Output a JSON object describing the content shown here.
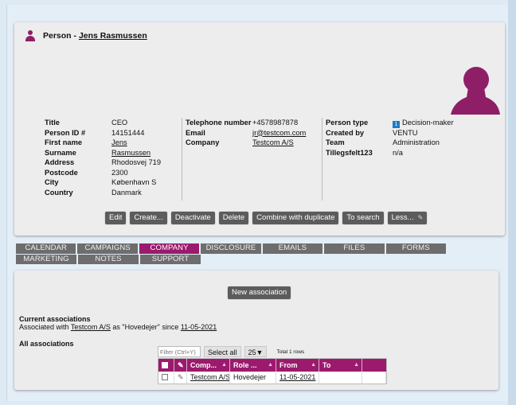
{
  "person": {
    "title_prefix": "Person - ",
    "name": "Jens Rasmussen"
  },
  "details": {
    "col1": [
      {
        "label": "Title",
        "value": "CEO"
      },
      {
        "label": "Person ID #",
        "value": "14151444"
      },
      {
        "label": "First name",
        "value": "Jens"
      },
      {
        "label": "Surname",
        "value": "Rasmussen"
      },
      {
        "label": "Address",
        "value": "Rhodosvej 719"
      },
      {
        "label": "Postcode",
        "value": "2300"
      },
      {
        "label": "City",
        "value": "København S"
      },
      {
        "label": "Country",
        "value": "Danmark"
      }
    ],
    "col2": [
      {
        "label": "Telephone number",
        "value": "+4578987878"
      },
      {
        "label": "Email",
        "value": "jr@testcom.com"
      },
      {
        "label": "Company",
        "value": "Testcom A/S"
      }
    ],
    "col3": [
      {
        "label": "Person type",
        "value": "Decision-maker",
        "badge": "1"
      },
      {
        "label": "Created by",
        "value": "VENTU"
      },
      {
        "label": "Team",
        "value": "Administration"
      },
      {
        "label": "Tillegsfelt123",
        "value": "n/a"
      }
    ]
  },
  "actions": [
    "Edit",
    "Create...",
    "Deactivate",
    "Delete",
    "Combine with duplicate",
    "To search",
    "Less..."
  ],
  "tabs": {
    "row1": [
      "CALENDAR",
      "CAMPAIGNS",
      "COMPANY",
      "DISCLOSURE",
      "EMAILS",
      "FILES",
      "FORMS"
    ],
    "row2": [
      "MARKETING",
      "NOTES",
      "SUPPORT"
    ],
    "active": "COMPANY"
  },
  "panel": {
    "new_association": "New association",
    "current_heading": "Current associations",
    "current_text_1": "Associated with ",
    "current_company": "Testcom A/S",
    "current_text_2": " as \"Hovedejer\" since ",
    "current_date": "11-05-2021",
    "all_heading": "All associations",
    "filter_placeholder": "Filter (Ctrl+Y)",
    "select_all": "Select all",
    "page_size": "25▼",
    "row_count": "Total 1 rows",
    "columns": [
      "Comp...",
      "Role ...",
      "From",
      "To"
    ],
    "rows": [
      {
        "company": "Testcom A/S",
        "role": "Hovedejer",
        "from": "11-05-2021",
        "to": ""
      }
    ]
  },
  "colors": {
    "accent": "#9b1a6d",
    "button": "#5c5c5c",
    "tab": "#6d6d6d",
    "background": "#dde9f3"
  },
  "icons": [
    "person-icon",
    "avatar-silhouette-icon",
    "pencil-icon",
    "sort-up-icon",
    "checkbox-icon",
    "badge-icon"
  ]
}
